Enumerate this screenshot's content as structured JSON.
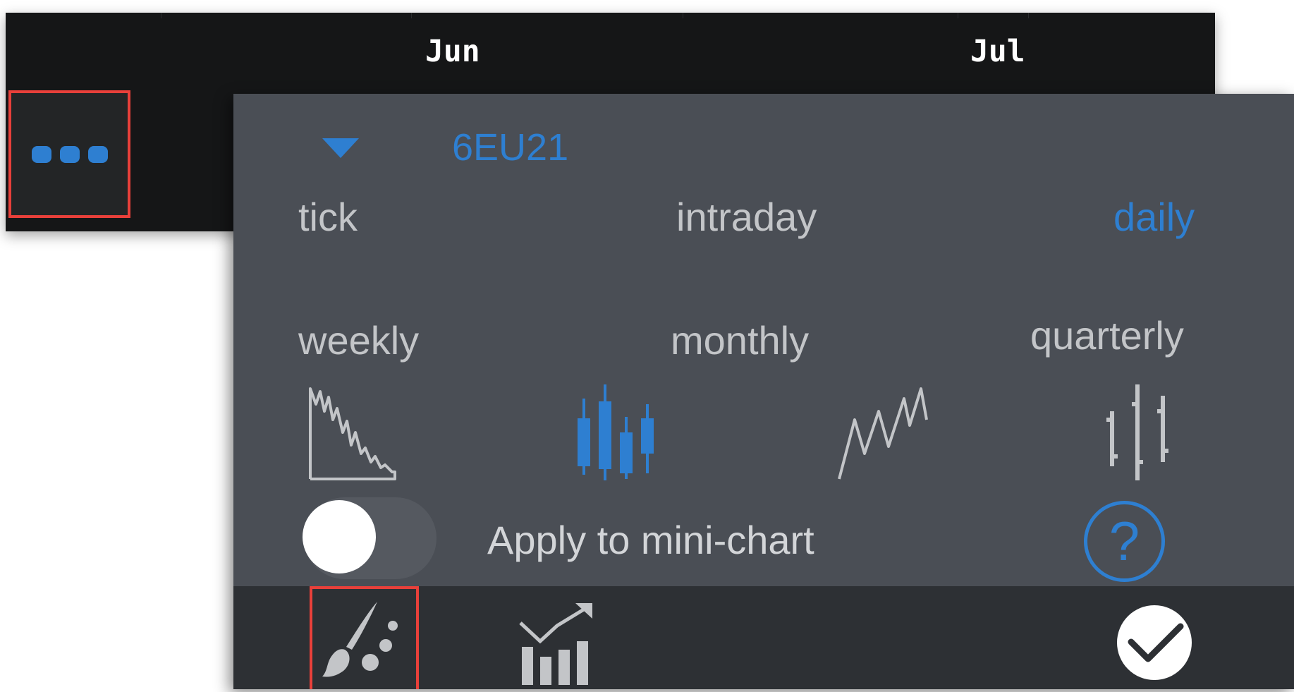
{
  "chart_header": {
    "months": [
      "Jun",
      "Jul"
    ]
  },
  "menu_button": {
    "icon": "more-dots-icon"
  },
  "panel": {
    "symbol": "6EU21",
    "periods": [
      {
        "label": "tick",
        "active": false
      },
      {
        "label": "intraday",
        "active": false
      },
      {
        "label": "daily",
        "active": true
      },
      {
        "label": "weekly",
        "active": false
      },
      {
        "label": "monthly",
        "active": false
      },
      {
        "label": "quarterly",
        "active": false
      }
    ],
    "chart_types": [
      {
        "icon": "area-chart-icon",
        "active": false
      },
      {
        "icon": "candlestick-chart-icon",
        "active": true
      },
      {
        "icon": "line-chart-icon",
        "active": false
      },
      {
        "icon": "ohlc-bar-chart-icon",
        "active": false
      }
    ],
    "apply_to_mini_chart": {
      "label": "Apply to mini-chart",
      "enabled": false
    },
    "help_label": "?"
  },
  "bottom_bar": {
    "buttons": [
      "paintbrush-icon",
      "chart-indicators-icon",
      "checkmark-icon"
    ]
  },
  "colors": {
    "accent": "#2e7fd1",
    "panel_bg": "#4a4e55",
    "bottom_bar_bg": "#2d3034",
    "highlight": "#e8403a"
  }
}
